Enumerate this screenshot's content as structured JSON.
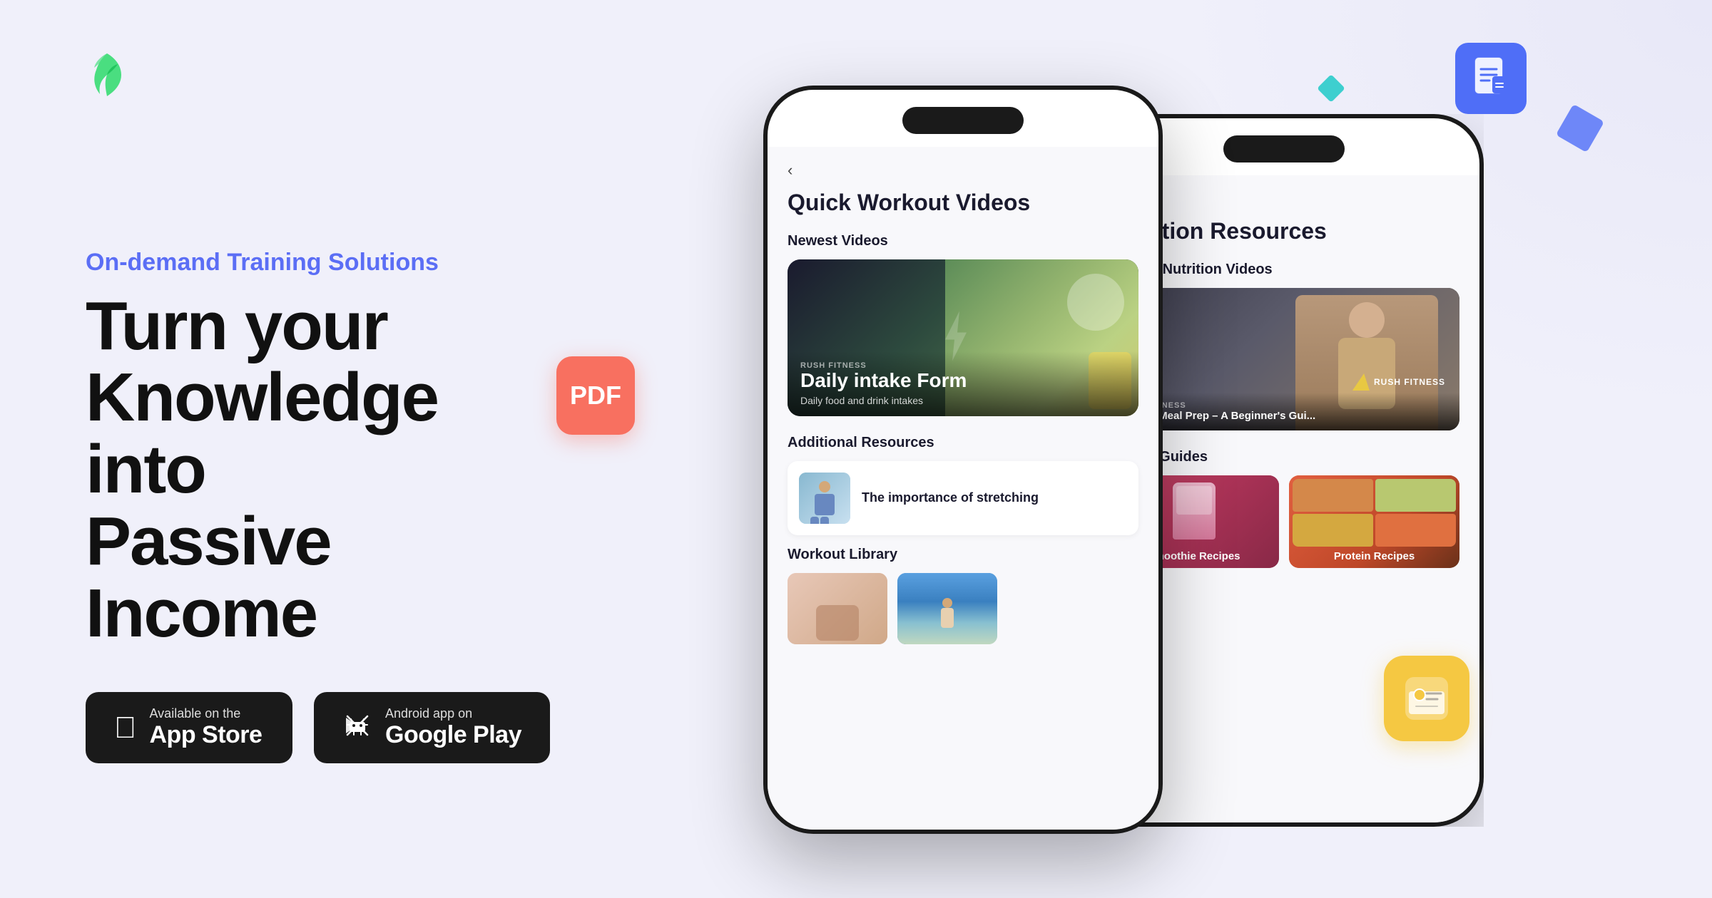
{
  "background": "#f0f0fa",
  "decorations": {
    "doc_icon_color": "#4f6ef7",
    "teal_diamond_color": "#3ecfcf",
    "blue_diamond_color": "#4f6ef7"
  },
  "logo": {
    "alt": "Feather/Wing logo mark"
  },
  "hero": {
    "tagline": "On-demand Training Solutions",
    "headline_line1": "Turn your",
    "headline_line2": "Knowledge into",
    "headline_line3": "Passive Income"
  },
  "pdf_badge": {
    "label": "PDF"
  },
  "store_buttons": {
    "appstore": {
      "top_text": "Available on the",
      "main_text": "App Store"
    },
    "googleplay": {
      "top_text": "Android app on",
      "main_text": "Google Play"
    }
  },
  "phone_main": {
    "back_icon": "‹",
    "screen_title": "Quick Workout Videos",
    "sections": [
      {
        "label": "Newest Videos",
        "video_card": {
          "main_title": "Daily intake Form",
          "brand": "RUSH FITNESS",
          "subtitle": "Daily food and drink intakes"
        }
      },
      {
        "label": "Additional Resources",
        "resource": {
          "title": "The importance of stretching"
        }
      },
      {
        "label": "Workout Library"
      }
    ]
  },
  "phone_secondary": {
    "back_icon": "‹",
    "screen_title": "Nutrition Resources",
    "sections": [
      {
        "label": "Newest Nutrition Videos",
        "video": {
          "brand": "RUSH FITNESS",
          "title": "How to Meal Prep – A Beginner's Gui..."
        }
      },
      {
        "label": "Recipe Guides",
        "cards": [
          {
            "title": "Smoothie Recipes"
          },
          {
            "title": "Protein Recipes"
          }
        ]
      }
    ]
  },
  "floating_icon": {
    "color": "#f5c842"
  }
}
